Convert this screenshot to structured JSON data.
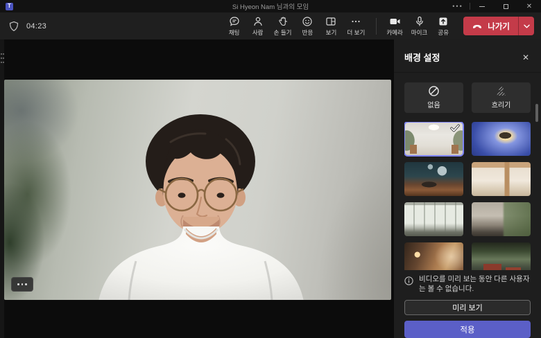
{
  "window": {
    "title": "Si Hyeon Nam 님과의 모임"
  },
  "toolbar": {
    "timer": "04:23",
    "buttons": [
      {
        "label": "채팅",
        "icon": "chat-icon"
      },
      {
        "label": "사람",
        "icon": "people-icon"
      },
      {
        "label": "손 들기",
        "icon": "raise-hand-icon"
      },
      {
        "label": "반응",
        "icon": "reactions-icon"
      },
      {
        "label": "보기",
        "icon": "view-icon"
      },
      {
        "label": "더 보기",
        "icon": "more-icon"
      }
    ],
    "devices": [
      {
        "label": "카메라",
        "icon": "camera-icon"
      },
      {
        "label": "마이크",
        "icon": "microphone-icon"
      },
      {
        "label": "공유",
        "icon": "share-icon"
      }
    ],
    "leave_label": "나가기"
  },
  "panel": {
    "title": "배경 설정",
    "options": [
      {
        "label": "없음",
        "icon": "none-icon"
      },
      {
        "label": "흐리기",
        "icon": "blur-icon"
      }
    ],
    "backgrounds": [
      {
        "name": "white-room",
        "selected": true
      },
      {
        "name": "space",
        "selected": false
      },
      {
        "name": "alien-planet",
        "selected": false
      },
      {
        "name": "wood-interior",
        "selected": false
      },
      {
        "name": "bright-window",
        "selected": false
      },
      {
        "name": "plant-lounge",
        "selected": false
      },
      {
        "name": "warm-living",
        "selected": false
      },
      {
        "name": "green-atrium",
        "selected": false
      }
    ],
    "info_text": "비디오를 미리 보는 동안 다른 사용자는 볼 수 없습니다.",
    "preview_label": "미리 보기",
    "apply_label": "적용"
  },
  "colors": {
    "accent": "#5b5fc7",
    "leave_red": "#c43b49",
    "selected_border": "#7f85f5"
  }
}
